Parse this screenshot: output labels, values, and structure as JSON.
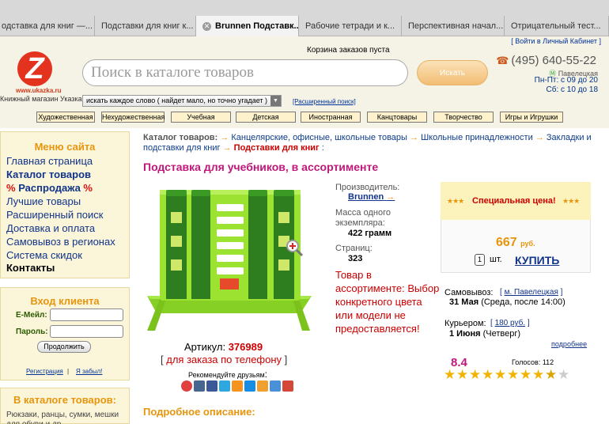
{
  "browser": {
    "tabs": [
      {
        "label": "одставка для книг —..."
      },
      {
        "label": "Подставки для книг к..."
      },
      {
        "label": "Brunnen Подставк...",
        "active": true
      },
      {
        "label": "Рабочие тетради и к..."
      },
      {
        "label": "Перспективная начал..."
      },
      {
        "label": "Отрицательный тест..."
      }
    ],
    "close_glyph": "✕"
  },
  "header": {
    "login_link": "[ Войти в Личный Кабинет ]",
    "logo_letter": "Z",
    "logo_url": "www.ukazka.ru",
    "logo_tagline": "Книжный магазин Указка",
    "cart_status": "Корзина заказов пуста",
    "search_placeholder": "Поиск в каталоге товаров",
    "search_button": "Искать",
    "phone": "(495) 640-55-22",
    "metro": "Павелецкая",
    "hours_weekdays": "Пн-Пт: с 09 до 20",
    "hours_saturday": "Сб: с 10 до 18",
    "search_mode": "искать каждое слово ( найдет мало, но точно угадает )",
    "advanced_search": "[Расширенный поиск]",
    "categories": [
      "Художественная",
      "Нехудожественная",
      "Учебная",
      "Детская",
      "Иностранная",
      "Канцтовары",
      "Творчество",
      "Игры и Игрушки"
    ]
  },
  "sidebar": {
    "menu_title": "Меню сайта",
    "menu_items": [
      "Главная страница",
      "Каталог товаров",
      "Распродажа",
      "Лучшие товары",
      "Расширенный поиск",
      "Доставка и оплата",
      "Самовывоз в регионах",
      "Система скидок",
      "Контакты"
    ],
    "sale_marker": "%",
    "login_title": "Вход клиента",
    "email_label": "E-Мейл:",
    "password_label": "Пароль:",
    "login_button": "Продолжить",
    "register_link": "Регистрация",
    "separator": "|",
    "forgot_link": "Я забыл!",
    "catalog_title": "В каталоге товаров:",
    "catalog_first_item": "Рюкзаки, ранцы, сумки, мешки для обуви и др."
  },
  "breadcrumb": {
    "label": "Каталог товаров:",
    "arrow": "→",
    "items": [
      "Канцелярские, офисные, школьные товары",
      "Школьные принадлежности",
      "Закладки и подставки для книг"
    ],
    "current": "Подставки для книг",
    "suffix": ":"
  },
  "product": {
    "title": "Подставка для учебников, в ассортименте",
    "article_label": "Артикул:",
    "article": "376989",
    "order_by_phone": "для заказа по телефону",
    "bracket_open": "[",
    "bracket_close": "]",
    "recommend": "Рекомендуйте друзьям",
    "recommend_colon": ":",
    "publisher_label": "Производитель:",
    "publisher": "Brunnen",
    "weight_label": "Масса одного экземпляра:",
    "weight": "422 грамм",
    "pages_label": "Страниц:",
    "pages": "323",
    "note": "Товар в ассортименте: Выбор конкретного цвета или модели не предоставляется!"
  },
  "offer": {
    "special_label": "Специальная цена!",
    "price": "667",
    "currency": "руб.",
    "qty": "1",
    "qty_unit": "шт.",
    "buy": "КУПИТЬ",
    "pickup_label": "Самовывоз:",
    "pickup_link": "м. Павелецкая",
    "pickup_date_bold": "31 Мая",
    "pickup_date_rest": "(Среда, после 14:00)",
    "courier_label": "Курьером:",
    "courier_price": "180 руб.",
    "courier_date_bold": "1 Июня",
    "courier_date_rest": "(Четверг)",
    "more": "подробнее",
    "rating": "8.4",
    "votes": "Голосов: 112"
  },
  "description": {
    "title": "Подробное описание:"
  },
  "colors": {
    "accent_orange": "#e8950e",
    "link_blue": "#12348a",
    "price_red": "#c00",
    "title_magenta": "#c0187a",
    "product_green": "#9be330"
  }
}
